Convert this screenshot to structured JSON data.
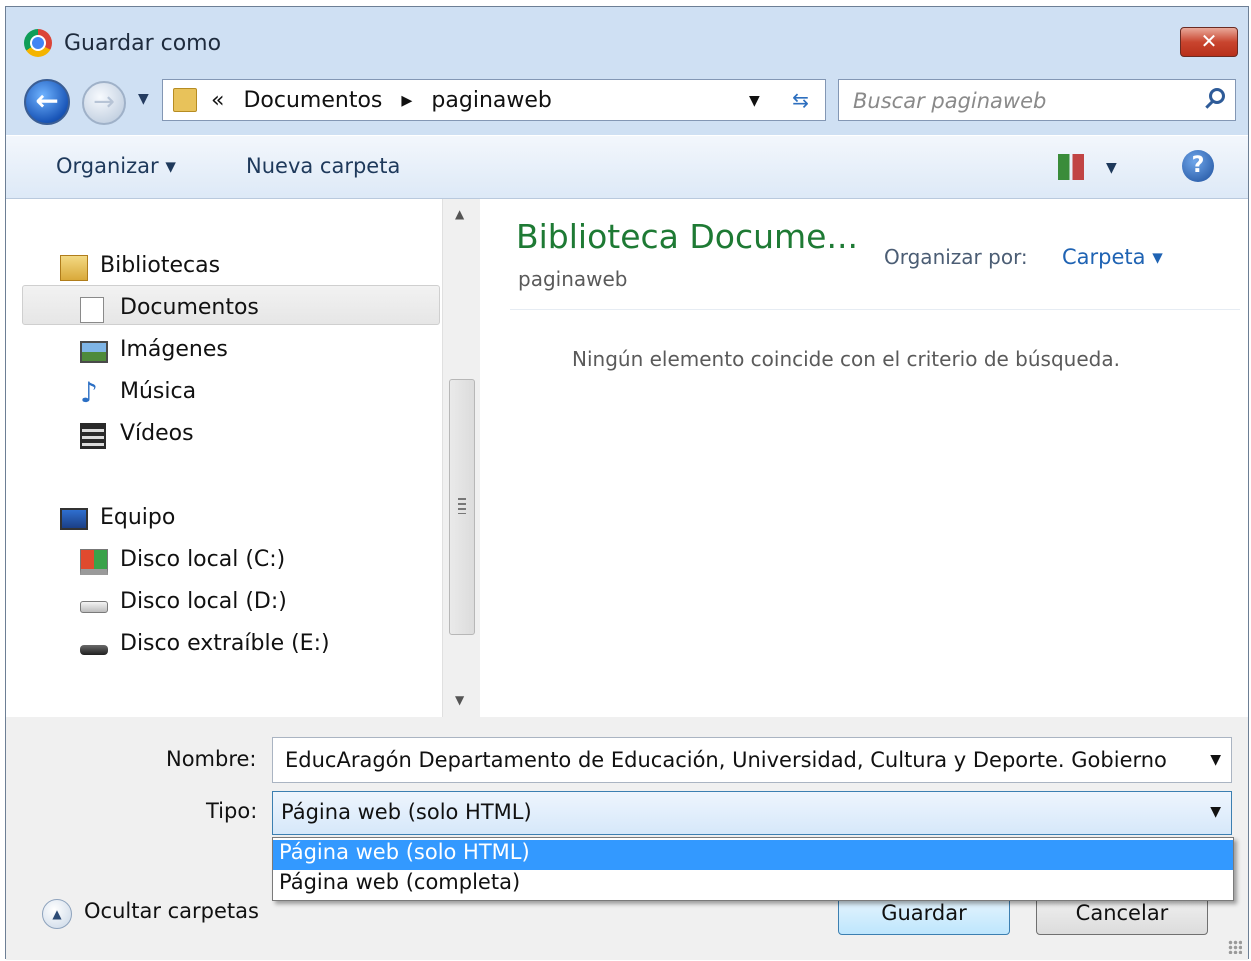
{
  "window": {
    "title": "Guardar como",
    "close_label": "✕"
  },
  "navigation": {
    "back_icon": "back-arrow-icon",
    "forward_icon": "forward-arrow-icon",
    "breadcrumb_overflow": "«",
    "path": [
      "Documentos",
      "paginaweb"
    ],
    "path_separator": "▸",
    "search_placeholder": "Buscar paginaweb"
  },
  "toolbar": {
    "organize_label": "Organizar ▾",
    "new_folder_label": "Nueva carpeta",
    "help_label": "?"
  },
  "sidebar": {
    "libraries_label": "Bibliotecas",
    "libraries": [
      {
        "label": "Documentos",
        "icon": "document-icon",
        "selected": true
      },
      {
        "label": "Imágenes",
        "icon": "pictures-icon"
      },
      {
        "label": "Música",
        "icon": "music-icon"
      },
      {
        "label": "Vídeos",
        "icon": "video-icon"
      }
    ],
    "computer_label": "Equipo",
    "drives": [
      {
        "label": "Disco local (C:)",
        "icon": "system-drive-icon"
      },
      {
        "label": "Disco local (D:)",
        "icon": "drive-icon"
      },
      {
        "label": "Disco extraíble (E:)",
        "icon": "removable-drive-icon"
      }
    ]
  },
  "content": {
    "library_title": "Biblioteca Docume...",
    "library_subtitle": "paginaweb",
    "arrange_label": "Organizar por:",
    "arrange_value": "Carpeta ▾",
    "empty_message": "Ningún elemento coincide con el criterio de búsqueda."
  },
  "form": {
    "name_label": "Nombre:",
    "name_value": "EducAragón    Departamento de Educación, Universidad, Cultura y Deporte. Gobierno",
    "type_label": "Tipo:",
    "type_value": "Página web (solo HTML)",
    "type_options": [
      "Página web (solo HTML)",
      "Página web (completa)"
    ]
  },
  "footer": {
    "hide_folders_label": "Ocultar carpetas",
    "save_label": "Guardar",
    "cancel_label": "Cancelar"
  },
  "colors": {
    "accent": "#3399ff",
    "library_title": "#1e7a34",
    "link": "#1f63b3"
  }
}
